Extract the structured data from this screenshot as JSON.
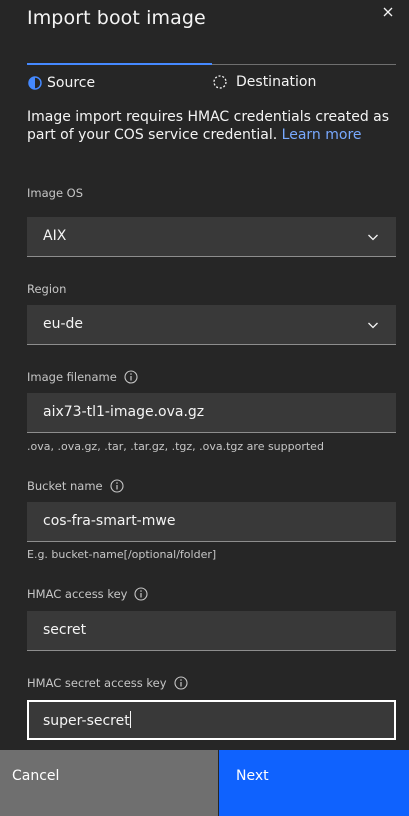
{
  "modal": {
    "title": "Import boot image"
  },
  "steps": [
    {
      "label": "Source",
      "state": "current"
    },
    {
      "label": "Destination",
      "state": "incomplete"
    }
  ],
  "description": {
    "text": "Image import requires HMAC credentials created as part of your COS service credential.",
    "link": "Learn more"
  },
  "fields": {
    "image_os": {
      "label": "Image OS",
      "value": "AIX"
    },
    "region": {
      "label": "Region",
      "value": "eu-de"
    },
    "image_filename": {
      "label": "Image filename",
      "value": "aix73-tl1-image.ova.gz",
      "helper": ".ova, .ova.gz, .tar, .tar.gz, .tgz, .ova.tgz are supported"
    },
    "bucket_name": {
      "label": "Bucket name",
      "value": "cos-fra-smart-mwe",
      "helper": "E.g. bucket-name[/optional/folder]"
    },
    "hmac_access_key": {
      "label": "HMAC access key",
      "value": "secret"
    },
    "hmac_secret_access_key": {
      "label": "HMAC secret access key",
      "value": "super-secret"
    }
  },
  "buttons": {
    "cancel": "Cancel",
    "next": "Next"
  },
  "colors": {
    "background": "#262626",
    "field": "#393939",
    "accent": "#0f62fe",
    "link": "#78a9ff",
    "progress": "#4589ff"
  }
}
